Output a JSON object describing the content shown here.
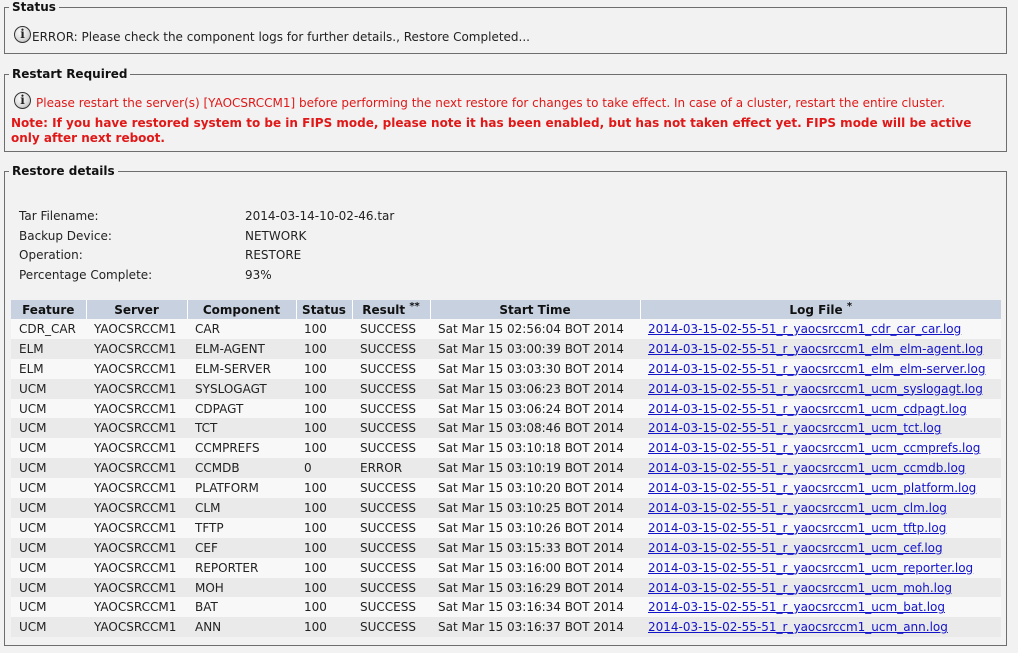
{
  "status": {
    "legend": "Status",
    "message": "ERROR: Please check the component logs for further details., Restore Completed..."
  },
  "restart": {
    "legend": "Restart Required",
    "message": "Please restart the server(s) [YAOCSRCCM1] before performing the next restore for changes to take effect. In case of a cluster, restart the entire cluster.",
    "note": "Note: If you have restored system to be in FIPS mode, please note it has been enabled, but has not taken effect yet. FIPS mode will be active only after next reboot."
  },
  "details": {
    "legend": "Restore details",
    "fields": [
      {
        "label": "Tar Filename:",
        "value": "2014-03-14-10-02-46.tar"
      },
      {
        "label": "Backup Device:",
        "value": "NETWORK"
      },
      {
        "label": "Operation:",
        "value": "RESTORE"
      },
      {
        "label": "Percentage Complete:",
        "value": "93%"
      }
    ]
  },
  "table": {
    "headers": {
      "feature": "Feature",
      "server": "Server",
      "component": "Component",
      "status": "Status",
      "result": "Result",
      "result_mark": "**",
      "start_time": "Start Time",
      "log_file": "Log File",
      "log_file_mark": "*"
    },
    "rows": [
      {
        "feature": "CDR_CAR",
        "server": "YAOCSRCCM1",
        "component": "CAR",
        "status": "100",
        "result": "SUCCESS",
        "start_time": "Sat Mar 15 02:56:04 BOT 2014",
        "log_file": "2014-03-15-02-55-51_r_yaocsrccm1_cdr_car_car.log"
      },
      {
        "feature": "ELM",
        "server": "YAOCSRCCM1",
        "component": "ELM-AGENT",
        "status": "100",
        "result": "SUCCESS",
        "start_time": "Sat Mar 15 03:00:39 BOT 2014",
        "log_file": "2014-03-15-02-55-51_r_yaocsrccm1_elm_elm-agent.log"
      },
      {
        "feature": "ELM",
        "server": "YAOCSRCCM1",
        "component": "ELM-SERVER",
        "status": "100",
        "result": "SUCCESS",
        "start_time": "Sat Mar 15 03:03:30 BOT 2014",
        "log_file": "2014-03-15-02-55-51_r_yaocsrccm1_elm_elm-server.log"
      },
      {
        "feature": "UCM",
        "server": "YAOCSRCCM1",
        "component": "SYSLOGAGT",
        "status": "100",
        "result": "SUCCESS",
        "start_time": "Sat Mar 15 03:06:23 BOT 2014",
        "log_file": "2014-03-15-02-55-51_r_yaocsrccm1_ucm_syslogagt.log"
      },
      {
        "feature": "UCM",
        "server": "YAOCSRCCM1",
        "component": "CDPAGT",
        "status": "100",
        "result": "SUCCESS",
        "start_time": "Sat Mar 15 03:06:24 BOT 2014",
        "log_file": "2014-03-15-02-55-51_r_yaocsrccm1_ucm_cdpagt.log"
      },
      {
        "feature": "UCM",
        "server": "YAOCSRCCM1",
        "component": "TCT",
        "status": "100",
        "result": "SUCCESS",
        "start_time": "Sat Mar 15 03:08:46 BOT 2014",
        "log_file": "2014-03-15-02-55-51_r_yaocsrccm1_ucm_tct.log"
      },
      {
        "feature": "UCM",
        "server": "YAOCSRCCM1",
        "component": "CCMPREFS",
        "status": "100",
        "result": "SUCCESS",
        "start_time": "Sat Mar 15 03:10:18 BOT 2014",
        "log_file": "2014-03-15-02-55-51_r_yaocsrccm1_ucm_ccmprefs.log"
      },
      {
        "feature": "UCM",
        "server": "YAOCSRCCM1",
        "component": "CCMDB",
        "status": "0",
        "result": "ERROR",
        "start_time": "Sat Mar 15 03:10:19 BOT 2014",
        "log_file": "2014-03-15-02-55-51_r_yaocsrccm1_ucm_ccmdb.log"
      },
      {
        "feature": "UCM",
        "server": "YAOCSRCCM1",
        "component": "PLATFORM",
        "status": "100",
        "result": "SUCCESS",
        "start_time": "Sat Mar 15 03:10:20 BOT 2014",
        "log_file": "2014-03-15-02-55-51_r_yaocsrccm1_ucm_platform.log"
      },
      {
        "feature": "UCM",
        "server": "YAOCSRCCM1",
        "component": "CLM",
        "status": "100",
        "result": "SUCCESS",
        "start_time": "Sat Mar 15 03:10:25 BOT 2014",
        "log_file": "2014-03-15-02-55-51_r_yaocsrccm1_ucm_clm.log"
      },
      {
        "feature": "UCM",
        "server": "YAOCSRCCM1",
        "component": "TFTP",
        "status": "100",
        "result": "SUCCESS",
        "start_time": "Sat Mar 15 03:10:26 BOT 2014",
        "log_file": "2014-03-15-02-55-51_r_yaocsrccm1_ucm_tftp.log"
      },
      {
        "feature": "UCM",
        "server": "YAOCSRCCM1",
        "component": "CEF",
        "status": "100",
        "result": "SUCCESS",
        "start_time": "Sat Mar 15 03:15:33 BOT 2014",
        "log_file": "2014-03-15-02-55-51_r_yaocsrccm1_ucm_cef.log"
      },
      {
        "feature": "UCM",
        "server": "YAOCSRCCM1",
        "component": "REPORTER",
        "status": "100",
        "result": "SUCCESS",
        "start_time": "Sat Mar 15 03:16:00 BOT 2014",
        "log_file": "2014-03-15-02-55-51_r_yaocsrccm1_ucm_reporter.log"
      },
      {
        "feature": "UCM",
        "server": "YAOCSRCCM1",
        "component": "MOH",
        "status": "100",
        "result": "SUCCESS",
        "start_time": "Sat Mar 15 03:16:29 BOT 2014",
        "log_file": "2014-03-15-02-55-51_r_yaocsrccm1_ucm_moh.log"
      },
      {
        "feature": "UCM",
        "server": "YAOCSRCCM1",
        "component": "BAT",
        "status": "100",
        "result": "SUCCESS",
        "start_time": "Sat Mar 15 03:16:34 BOT 2014",
        "log_file": "2014-03-15-02-55-51_r_yaocsrccm1_ucm_bat.log"
      },
      {
        "feature": "UCM",
        "server": "YAOCSRCCM1",
        "component": "ANN",
        "status": "100",
        "result": "SUCCESS",
        "start_time": "Sat Mar 15 03:16:37 BOT 2014",
        "log_file": "2014-03-15-02-55-51_r_yaocsrccm1_ucm_ann.log"
      }
    ]
  },
  "icons": {
    "info": "info-icon"
  },
  "colors": {
    "error_red": "#e01818",
    "link_blue": "#1414c8",
    "header_bg": "#c7d1df"
  }
}
